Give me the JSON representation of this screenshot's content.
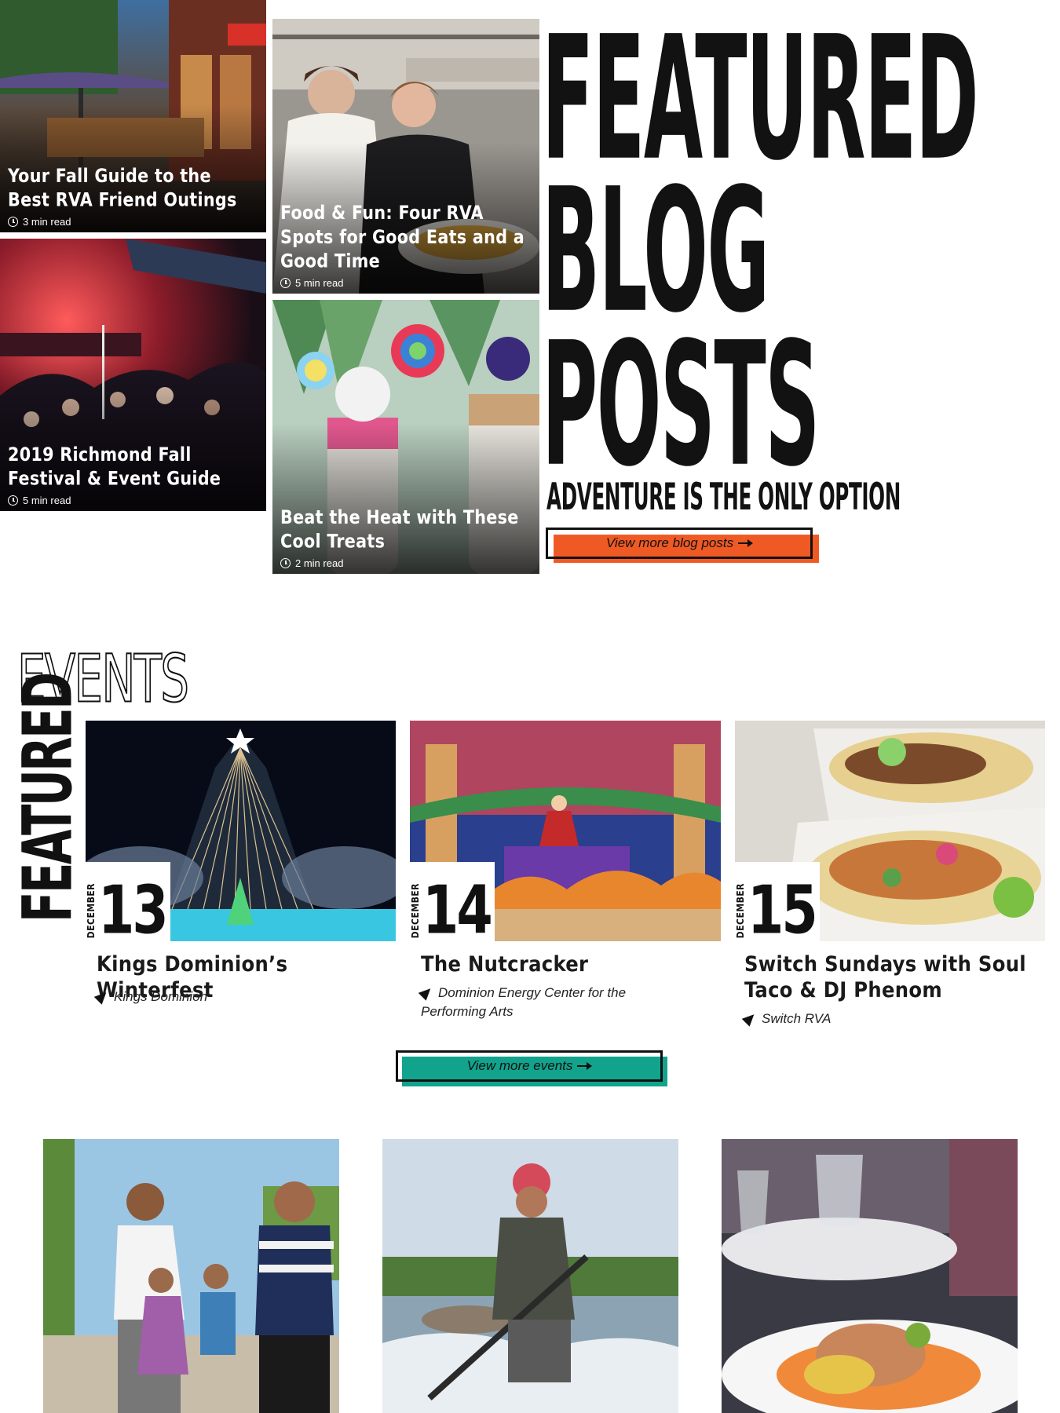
{
  "blog": {
    "heading_line1": "FEATURED",
    "heading_line2": "BLOG",
    "heading_line3": "POSTS",
    "tagline": "ADVENTURE IS THE ONLY OPTION",
    "cta_label": "View more blog posts",
    "posts": [
      {
        "title": "Your Fall Guide to the Best RVA Friend Outings",
        "read_time": "3 min read"
      },
      {
        "title": "2019 Richmond Fall Festival & Event Guide",
        "read_time": "5 min read"
      },
      {
        "title": "Food & Fun: Four RVA Spots for Good Eats and a Good Time",
        "read_time": "5 min read"
      },
      {
        "title": "Beat the Heat with These Cool Treats",
        "read_time": "2 min read"
      }
    ]
  },
  "events": {
    "heading_outline": "EVENTS",
    "heading_vertical": "FEATURED",
    "cta_label": "View more events",
    "items": [
      {
        "month": "DECEMBER",
        "day": "13",
        "title": "Kings Dominion’s Winterfest",
        "location": "Kings Dominion"
      },
      {
        "month": "DECEMBER",
        "day": "14",
        "title": "The Nutcracker",
        "location": "Dominion Energy Center for the Performing Arts"
      },
      {
        "month": "DECEMBER",
        "day": "15",
        "title": "Switch Sundays with Soul Taco & DJ Phenom",
        "location": "Switch RVA"
      }
    ]
  },
  "colors": {
    "blog_cta": "#ef5a24",
    "events_cta": "#12a38d",
    "heading": "#121212"
  },
  "icons": [
    "clock-icon",
    "arrow-right-icon",
    "location-arrow-icon"
  ]
}
